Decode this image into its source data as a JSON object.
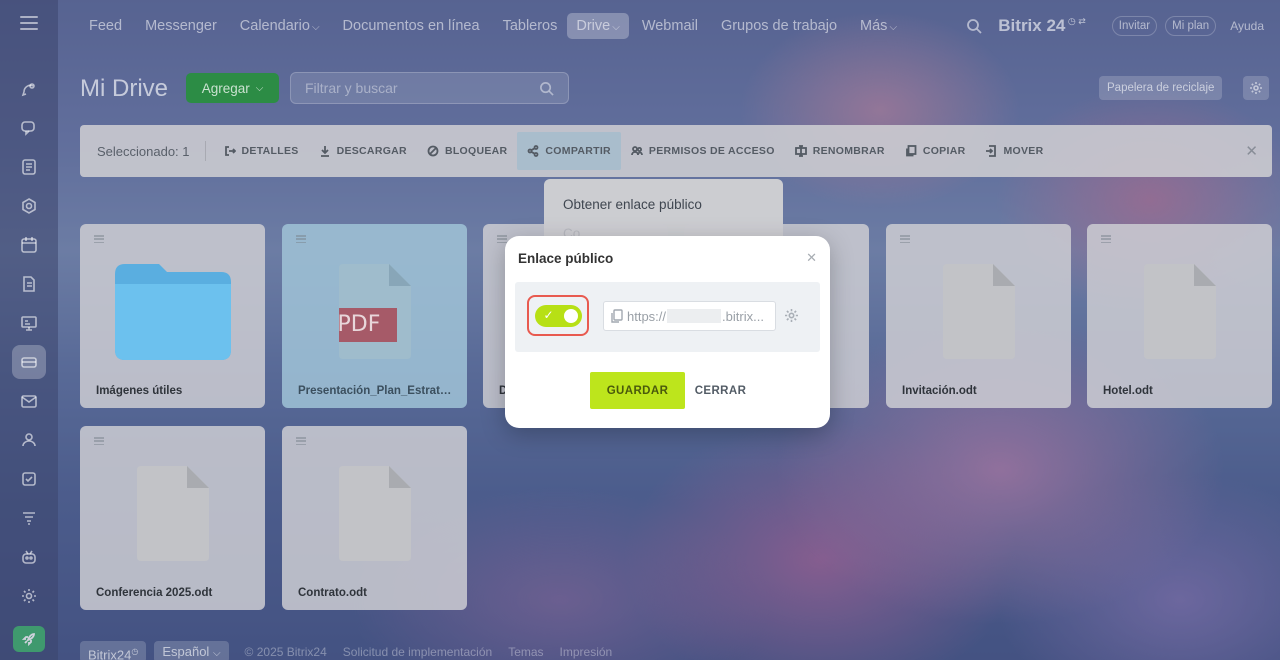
{
  "topnav": {
    "items": [
      "Feed",
      "Messenger",
      "Calendario",
      "Documentos en línea",
      "Tableros",
      "Drive",
      "Webmail",
      "Grupos de trabajo",
      "Más"
    ],
    "brand": "Bitrix 24",
    "invite": "Invitar",
    "plan": "Mi plan",
    "help": "Ayuda"
  },
  "header": {
    "title": "Mi Drive",
    "add_label": "Agregar",
    "filter_placeholder": "Filtrar y buscar",
    "trash_label": "Papelera de reciclaje"
  },
  "actionbar": {
    "selected": "Seleccionado: 1",
    "details": "DETALLES",
    "download": "DESCARGAR",
    "lock": "BLOQUEAR",
    "share": "COMPARTIR",
    "permissions": "PERMISOS DE ACCESO",
    "rename": "RENOMBRAR",
    "copy": "COPIAR",
    "move": "MOVER"
  },
  "share_menu": {
    "public_link": "Obtener enlace público",
    "second": "Co"
  },
  "files": [
    {
      "name": "Imágenes útiles",
      "type": "folder"
    },
    {
      "name": "Presentación_Plan_Estratégico",
      "type": "pdf"
    },
    {
      "name": "D",
      "type": "doc"
    },
    {
      "name": "Invitación.odt",
      "type": "doc"
    },
    {
      "name": "Hotel.odt",
      "type": "doc"
    },
    {
      "name": "Conferencia 2025.odt",
      "type": "doc"
    },
    {
      "name": "Contrato.odt",
      "type": "doc"
    }
  ],
  "pdf_badge": "PDF",
  "modal": {
    "title": "Enlace público",
    "link_prefix": "https://",
    "link_suffix": ".bitrix...",
    "toggle_on": true,
    "save": "GUARDAR",
    "close": "CERRAR"
  },
  "footer": {
    "brand": "Bitrix24",
    "language": "Español",
    "copyright": "© 2025 Bitrix24",
    "implementation": "Solicitud de implementación",
    "themes": "Temas",
    "print": "Impresión"
  },
  "colors": {
    "accent_green": "#bde51c",
    "add_button": "#2c8c45",
    "highlight": "#e85a4f"
  }
}
